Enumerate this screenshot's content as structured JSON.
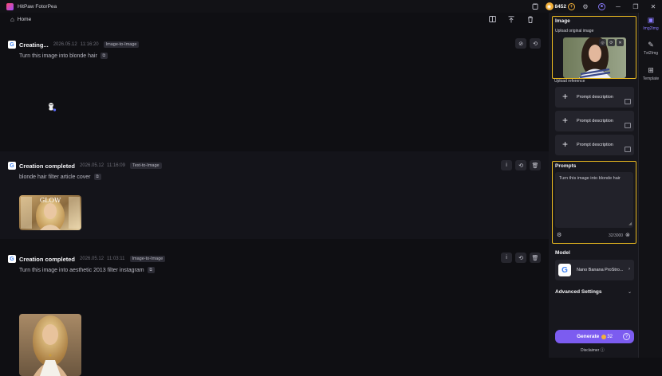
{
  "app": {
    "title": "HitPaw FotorPea"
  },
  "header": {
    "credits": "8452"
  },
  "home": {
    "label": "Home"
  },
  "feed": [
    {
      "status": "Creating...",
      "date": "2026.05.12",
      "time": "11:16:20",
      "tag": "Image-to-Image",
      "prompt": "Turn this image into blonde hair"
    },
    {
      "status": "Creation completed",
      "date": "2026.05.12",
      "time": "11:16:09",
      "tag": "Text-to-Image",
      "prompt": "blonde hair filter article cover",
      "thumb_text": "GLOW"
    },
    {
      "status": "Creation completed",
      "date": "2026.05.12",
      "time": "11:03:11",
      "tag": "Image-to-Image",
      "prompt": "Turn this image into aesthetic 2013 filter instagram"
    }
  ],
  "panel": {
    "image_title": "Image",
    "upload_original": "Upload original image",
    "upload_reference": "Upload reference",
    "references": [
      "Prompt description",
      "Prompt description",
      "Prompt description"
    ],
    "prompts_title": "Prompts",
    "prompt_text": "Turn this image into blonde hair",
    "counter": "32/3000",
    "model_title": "Model",
    "model_name": "Nano Banana ProStro...",
    "advanced": "Advanced Settings",
    "generate": "Generate",
    "generate_cost": "32",
    "disclaimer": "Disclaimer"
  },
  "rail": [
    {
      "label": "Img2Img",
      "icon": "image-icon",
      "active": true
    },
    {
      "label": "Txt2Img",
      "icon": "text-image-icon",
      "active": false
    },
    {
      "label": "Template",
      "icon": "template-icon",
      "active": false
    }
  ],
  "colors": {
    "accent": "#7c5cf0",
    "highlight": "#e8b820",
    "coin": "#f2b03a",
    "background": "#0f0f13"
  }
}
